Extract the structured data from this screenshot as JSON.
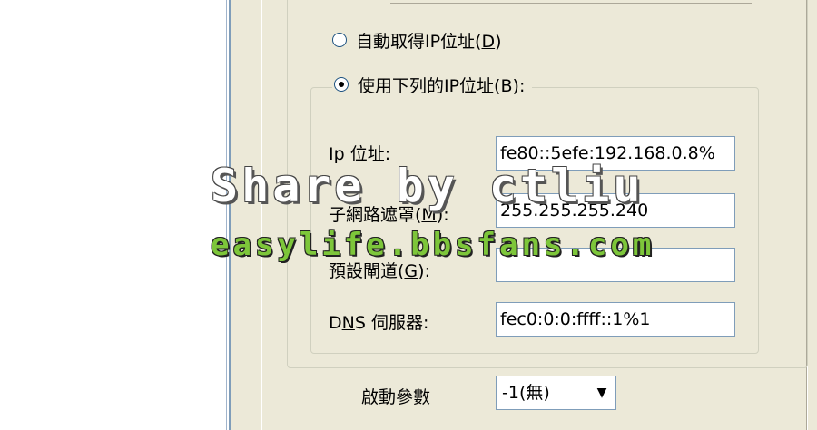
{
  "ip_mode": {
    "auto_label": "自動取得IP位址(",
    "auto_key": "D",
    "auto_tail": ")",
    "manual_label": "使用下列的IP位址(",
    "manual_key": "B",
    "manual_tail": "):",
    "selected": "manual"
  },
  "fields": {
    "ip": {
      "label_key": "I",
      "label_rest": "p 位址:",
      "value": "fe80::5efe:192.168.0.8%"
    },
    "subnet": {
      "label_pre": "子網路遮罩(",
      "label_key": "M",
      "label_tail": "):",
      "value": "255.255.255.240"
    },
    "gateway": {
      "label_pre": "預設閘道(",
      "label_key": "G",
      "label_tail": "):",
      "value": ""
    },
    "dns": {
      "label_pre": "D",
      "label_key": "N",
      "label_tail": "S 伺服器:",
      "value": "fec0:0:0:ffff::1%1"
    }
  },
  "startup": {
    "label": "啟動參數",
    "value": "-1(無)",
    "arrow_icon": "▼"
  },
  "watermark": {
    "line1": "Share by ctliu",
    "line2": "easylife.bbsfans.com"
  },
  "colors": {
    "dialog_bg": "#ece9d8",
    "field_border": "#7f9db9",
    "watermark_green": "#7dc63a"
  }
}
